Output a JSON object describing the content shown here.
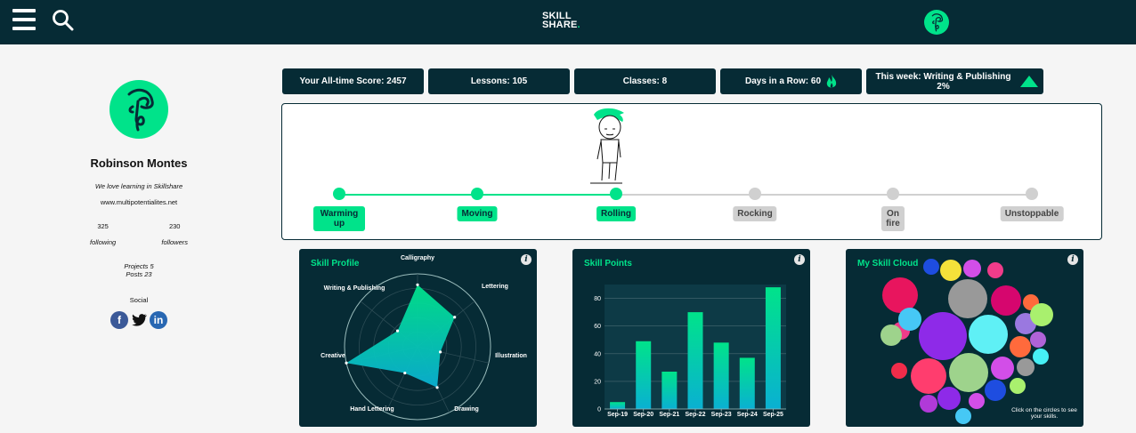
{
  "header": {
    "logo_line1": "SKILL",
    "logo_line2": "SHARE",
    "logo_dot": "."
  },
  "profile": {
    "name": "Robinson Montes",
    "tagline": "We love learning in Skillshare",
    "website": "www.multipotentialites.net",
    "following_count": "325",
    "following_label": "following",
    "followers_count": "230",
    "followers_label": "followers",
    "projects": "Projects 5",
    "posts": "Posts 23",
    "social_label": "Social"
  },
  "stats": {
    "score": "Your All-time Score: 2457",
    "lessons": "Lessons: 105",
    "classes": "Classes: 8",
    "days": "Days in a Row: 60",
    "week": "This week: Writing & Publishing 2%"
  },
  "levels": [
    {
      "label": "Warming up",
      "active": true
    },
    {
      "label": "Moving",
      "active": true
    },
    {
      "label": "Rolling",
      "active": true
    },
    {
      "label": "Rocking",
      "active": false
    },
    {
      "label": "On fire",
      "active": false
    },
    {
      "label": "Unstoppable",
      "active": false
    }
  ],
  "current_level": "Rolling",
  "colors": {
    "dark": "#062b35",
    "accent": "#00e38a",
    "inactive": "#d0d0d0"
  },
  "icons": [
    "menu-icon",
    "search-icon",
    "avatar",
    "flame-icon",
    "up-triangle-icon",
    "info-icon",
    "facebook-icon",
    "twitter-icon",
    "linkedin-icon"
  ],
  "cards": {
    "profile_title": "Skill Profile",
    "points_title": "Skill Points",
    "cloud_title": "My Skill Cloud",
    "cloud_hint": "Click on the circles to see your skills.",
    "info_glyph": "i"
  },
  "chart_data": [
    {
      "type": "radar",
      "title": "Skill Profile",
      "categories": [
        "Calligraphy",
        "Lettering",
        "Illustration",
        "Drawing",
        "Hand Lettering",
        "Creative",
        "Writing & Publishing"
      ],
      "values": [
        0.85,
        0.65,
        0.32,
        0.62,
        0.4,
        1.0,
        0.35
      ],
      "max": 1
    },
    {
      "type": "bar",
      "title": "Skill Points",
      "categories": [
        "Sep-19",
        "Sep-20",
        "Sep-21",
        "Sep-22",
        "Sep-23",
        "Sep-24",
        "Sep-25"
      ],
      "values": [
        5,
        49,
        27,
        70,
        48,
        37,
        88
      ],
      "ylim": [
        0,
        90
      ],
      "yticks": [
        0,
        20,
        40,
        60,
        80
      ]
    }
  ],
  "skill_cloud": [
    {
      "color": "#1e4de0",
      "r": 9
    },
    {
      "color": "#f4e13a",
      "r": 12
    },
    {
      "color": "#d24ee8",
      "r": 10
    },
    {
      "color": "#f03c8a",
      "r": 9
    },
    {
      "color": "#e8155e",
      "r": 20
    },
    {
      "color": "#999999",
      "r": 22
    },
    {
      "color": "#d6066e",
      "r": 17
    },
    {
      "color": "#ff6a3c",
      "r": 9
    },
    {
      "color": "#f03c8a",
      "r": 10
    },
    {
      "color": "#46c8f5",
      "r": 13
    },
    {
      "color": "#8e2ae8",
      "r": 27
    },
    {
      "color": "#5ff0f5",
      "r": 22
    },
    {
      "color": "#9a78e0",
      "r": 12
    },
    {
      "color": "#9ed38c",
      "r": 12
    },
    {
      "color": "#a9f06e",
      "r": 13
    },
    {
      "color": "#ff6a3c",
      "r": 12
    },
    {
      "color": "#b063d8",
      "r": 9
    },
    {
      "color": "#46f0f5",
      "r": 9
    },
    {
      "color": "#f02c4a",
      "r": 9
    },
    {
      "color": "#ff3d6e",
      "r": 20
    },
    {
      "color": "#9ed38c",
      "r": 22
    },
    {
      "color": "#d24ee8",
      "r": 13
    },
    {
      "color": "#999999",
      "r": 10
    },
    {
      "color": "#1e4de0",
      "r": 12
    },
    {
      "color": "#a9f06e",
      "r": 9
    },
    {
      "color": "#8e2ae8",
      "r": 13
    },
    {
      "color": "#d24ee8",
      "r": 9
    },
    {
      "color": "#b03ad8",
      "r": 10
    },
    {
      "color": "#46c8f5",
      "r": 9
    }
  ]
}
